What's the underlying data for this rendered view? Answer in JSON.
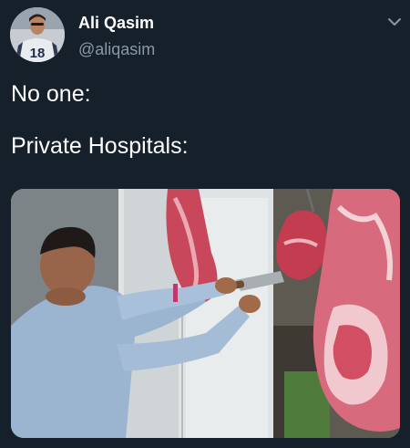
{
  "tweet": {
    "display_name": "Ali Qasim",
    "handle": "@aliqasim",
    "text_lines": [
      "No one:",
      "Private Hospitals:"
    ],
    "avatar_jersey_number": "18"
  },
  "icons": {
    "more_menu": "chevron-down-icon"
  },
  "media": {
    "description_icon": "photo"
  },
  "colors": {
    "background": "#15202b",
    "secondary_text": "#8899a6"
  }
}
